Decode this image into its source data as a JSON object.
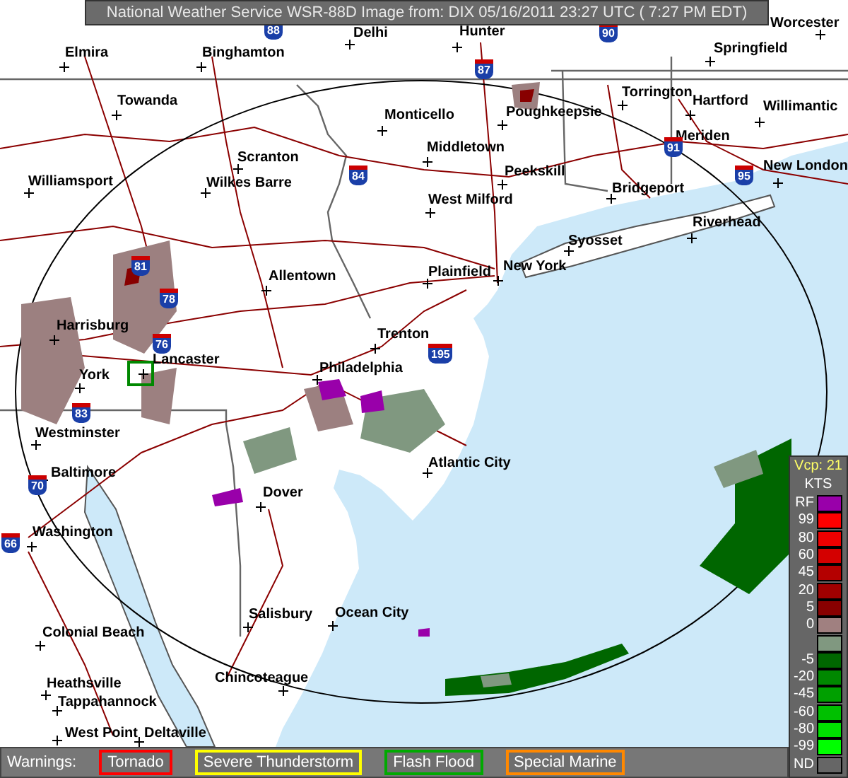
{
  "title": "National Weather Service WSR-88D Image from: DIX 05/16/2011 23:27 UTC ( 7:27 PM EDT)",
  "cities": [
    "Delhi",
    "Hunter",
    "Worcester",
    "Elmira",
    "Binghamton",
    "Springfield",
    "Towanda",
    "Torrington",
    "Hartford",
    "Willimantic",
    "Monticello",
    "Poughkeepsie",
    "Meriden",
    "Middletown",
    "Scranton",
    "New London",
    "Peekskill",
    "Williamsport",
    "Wilkes Barre",
    "Bridgeport",
    "West Milford",
    "Syosset",
    "Riverhead",
    "Allentown",
    "Plainfield",
    "New York",
    "Harrisburg",
    "Trenton",
    "Lancaster",
    "York",
    "Philadelphia",
    "Westminster",
    "Atlantic City",
    "Baltimore",
    "Dover",
    "Washington",
    "Salisbury",
    "Ocean City",
    "Colonial Beach",
    "Heathsville",
    "Chincoteague",
    "Tappahannock",
    "West Point",
    "Deltaville"
  ],
  "interstates": [
    "88",
    "90",
    "87",
    "84",
    "91",
    "95",
    "81",
    "78",
    "76",
    "195",
    "83",
    "70",
    "66"
  ],
  "legend": {
    "vcp": "Vcp: 21",
    "units": "KTS",
    "items": [
      {
        "label": "RF",
        "color": "#9900aa"
      },
      {
        "label": "99",
        "color": "#ff0000"
      },
      {
        "label": "80",
        "color": "#ee0000"
      },
      {
        "label": "60",
        "color": "#d40000"
      },
      {
        "label": "45",
        "color": "#b40000"
      },
      {
        "label": "20",
        "color": "#a00000"
      },
      {
        "label": "5",
        "color": "#880000"
      },
      {
        "label": "0",
        "color": "#a08080"
      },
      {
        "color": "#809880"
      },
      {
        "label": "-5",
        "color": "#006600"
      },
      {
        "label": "-20",
        "color": "#008800"
      },
      {
        "label": "-45",
        "color": "#00a000"
      },
      {
        "label": "-60",
        "color": "#00c000"
      },
      {
        "label": "-80",
        "color": "#00e000"
      },
      {
        "label": "-99",
        "color": "#00ff00"
      },
      {
        "label": "ND",
        "color": "#666666"
      }
    ]
  },
  "warnings": {
    "label": "Warnings:",
    "items": [
      {
        "label": "Tornado",
        "color": "#ff0000"
      },
      {
        "label": "Severe Thunderstorm",
        "color": "#ffff00"
      },
      {
        "label": "Flash Flood",
        "color": "#00aa00"
      },
      {
        "label": "Special Marine",
        "color": "#ff8800"
      }
    ]
  }
}
